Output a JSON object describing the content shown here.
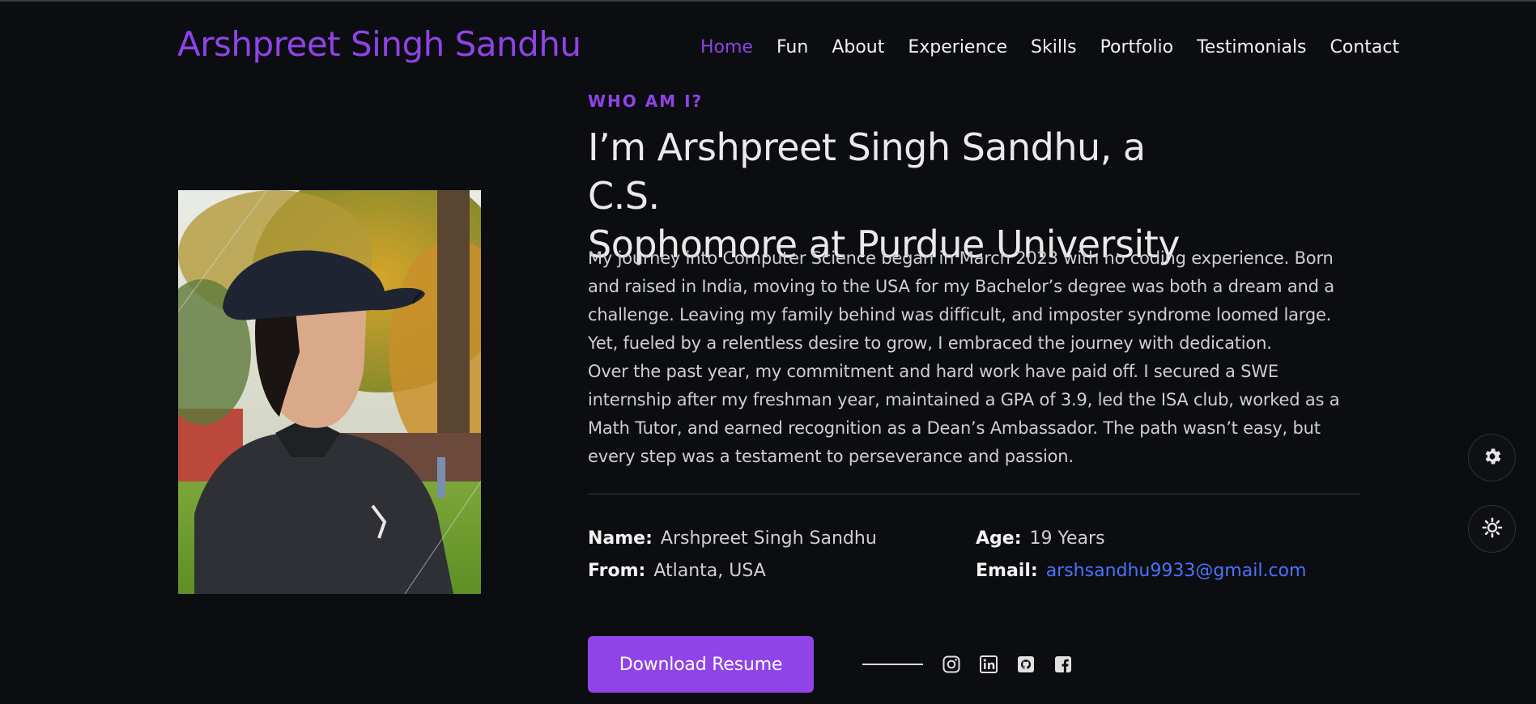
{
  "brand": "Arshpreet Singh Sandhu",
  "nav": [
    "Home",
    "Fun",
    "About",
    "Experience",
    "Skills",
    "Portfolio",
    "Testimonials",
    "Contact"
  ],
  "about": {
    "kicker": "WHO AM I?",
    "headline_line1": "I’m Arshpreet Singh Sandhu, a C.S.",
    "headline_line2": "Sophomore at Purdue University",
    "bio_p1": "My journey into Computer Science began in March 2023 with no coding experience. Born and raised in India, moving to the USA for my Bachelor’s degree was both a dream and a challenge. Leaving my family behind was difficult, and imposter syndrome loomed large. Yet, fueled by a relentless desire to grow, I embraced the journey with dedication.",
    "bio_p2": "Over the past year, my commitment and hard work have paid off. I secured a SWE internship after my freshman year, maintained a GPA of 3.9, led the ISA club, worked as a Math Tutor, and earned recognition as a Dean’s Ambassador. The path wasn’t easy, but every step was a testament to perseverance and passion."
  },
  "details": {
    "name_label": "Name:",
    "name_value": "Arshpreet Singh Sandhu",
    "from_label": "From:",
    "from_value": "Atlanta, USA",
    "age_label": "Age:",
    "age_value": "19 Years",
    "email_label": "Email:",
    "email_value": "arshsandhu9933@gmail.com"
  },
  "cta": {
    "download": "Download Resume"
  },
  "social_icons": [
    "instagram-icon",
    "linkedin-icon",
    "github-icon",
    "facebook-icon"
  ],
  "floating_icons": [
    "gear-icon",
    "sun-icon"
  ],
  "colors": {
    "accent": "#8f43e8",
    "link": "#4a73ff",
    "background": "#0c0d10"
  }
}
